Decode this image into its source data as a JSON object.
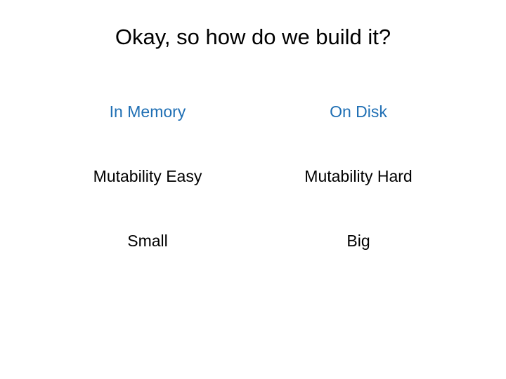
{
  "title": "Okay, so how do we build it?",
  "columns": {
    "left": {
      "header": "In Memory",
      "rows": [
        "Mutability Easy",
        "Small"
      ]
    },
    "right": {
      "header": "On Disk",
      "rows": [
        "Mutability Hard",
        "Big"
      ]
    }
  }
}
